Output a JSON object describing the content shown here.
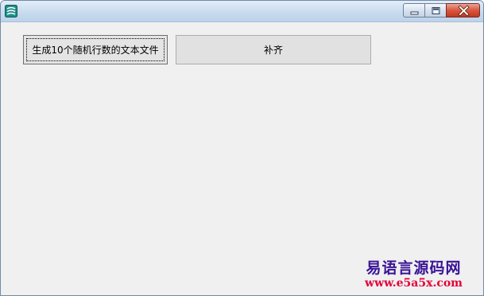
{
  "window": {
    "title": "",
    "icon": "app-icon"
  },
  "caption_buttons": {
    "minimize": "minimize-icon",
    "maximize": "maximize-icon",
    "close": "close-icon"
  },
  "buttons": {
    "generate_label": "生成10个随机行数的文本文件",
    "fill_label": "补齐"
  },
  "watermark": {
    "title": "易语言源码网",
    "url": "www.e5a5x.com"
  },
  "colors": {
    "window_bg": "#f0f0f0",
    "watermark_title": "#3a1396",
    "watermark_url": "#e4003a",
    "close_button": "#d7573f"
  }
}
